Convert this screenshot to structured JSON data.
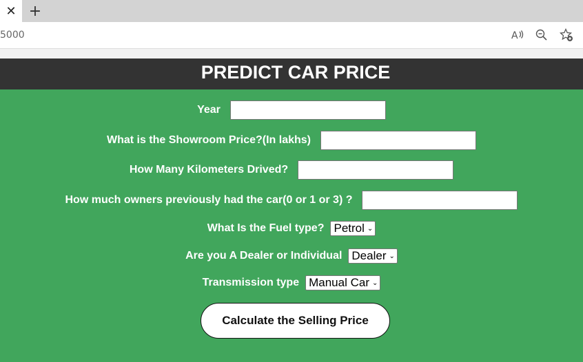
{
  "browser": {
    "close_tab_glyph": "✕",
    "new_tab_glyph": "+",
    "url": "5000",
    "icons": {
      "read_aloud": "read-aloud-icon",
      "zoom_out": "zoom-out-icon",
      "favorites": "add-favorite-icon"
    }
  },
  "header": {
    "title": "PREDICT CAR PRICE",
    "background": "#333333"
  },
  "page": {
    "background": "#41a65c"
  },
  "form": {
    "year_label": "Year",
    "year_value": "",
    "showroom_label": "What is the Showroom Price?(In lakhs)",
    "showroom_value": "",
    "km_label": "How Many Kilometers Drived?",
    "km_value": "",
    "owners_label": "How much owners previously had the car(0 or 1 or 3) ?",
    "owners_value": "",
    "fuel_label": "What Is the Fuel type?",
    "fuel_selected": "Petrol",
    "seller_label": "Are you A Dealer or Individual",
    "seller_selected": "Dealer",
    "transmission_label": "Transmission type",
    "transmission_selected": "Manual Car",
    "submit_label": "Calculate the Selling Price"
  }
}
